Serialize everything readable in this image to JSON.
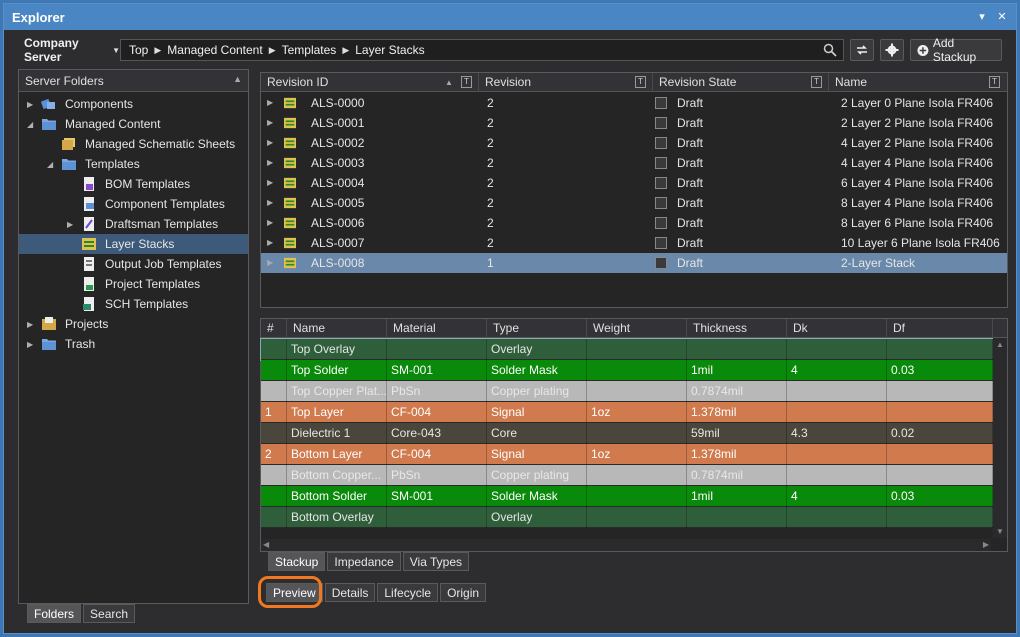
{
  "window": {
    "title": "Explorer"
  },
  "toolbar": {
    "server_label": "Company Server",
    "breadcrumb": [
      "Top",
      "Managed Content",
      "Templates",
      "Layer Stacks"
    ],
    "add_label": "Add Stackup"
  },
  "folders": {
    "header": "Server Folders",
    "items": [
      {
        "label": "Components",
        "level": 0,
        "expand": "collapsed",
        "icon": "components-icon"
      },
      {
        "label": "Managed Content",
        "level": 0,
        "expand": "expanded",
        "icon": "folder-icon"
      },
      {
        "label": "Managed Schematic Sheets",
        "level": 1,
        "expand": "none",
        "icon": "schematic-sheets-icon"
      },
      {
        "label": "Templates",
        "level": 1,
        "expand": "expanded",
        "icon": "folder-icon"
      },
      {
        "label": "BOM Templates",
        "level": 2,
        "expand": "none",
        "icon": "bom-template-icon"
      },
      {
        "label": "Component Templates",
        "level": 2,
        "expand": "none",
        "icon": "component-template-icon"
      },
      {
        "label": "Draftsman Templates",
        "level": 2,
        "expand": "collapsed",
        "icon": "draftsman-template-icon"
      },
      {
        "label": "Layer Stacks",
        "level": 2,
        "expand": "none",
        "icon": "layer-stack-icon",
        "selected": true
      },
      {
        "label": "Output Job Templates",
        "level": 2,
        "expand": "none",
        "icon": "output-job-icon"
      },
      {
        "label": "Project Templates",
        "level": 2,
        "expand": "none",
        "icon": "project-template-icon"
      },
      {
        "label": "SCH Templates",
        "level": 2,
        "expand": "none",
        "icon": "sch-template-icon"
      },
      {
        "label": "Projects",
        "level": 0,
        "expand": "collapsed",
        "icon": "projects-icon"
      },
      {
        "label": "Trash",
        "level": 0,
        "expand": "collapsed",
        "icon": "folder-icon"
      }
    ],
    "tabs": [
      "Folders",
      "Search"
    ]
  },
  "revisions": {
    "columns": [
      "Revision ID",
      "Revision",
      "Revision State",
      "Name"
    ],
    "rows": [
      {
        "id": "ALS-0000",
        "rev": "2",
        "state": "Draft",
        "name": "2 Layer 0 Plane Isola FR406"
      },
      {
        "id": "ALS-0001",
        "rev": "2",
        "state": "Draft",
        "name": "2 Layer 2 Plane Isola FR406"
      },
      {
        "id": "ALS-0002",
        "rev": "2",
        "state": "Draft",
        "name": "4 Layer 2 Plane Isola FR406"
      },
      {
        "id": "ALS-0003",
        "rev": "2",
        "state": "Draft",
        "name": "4 Layer 4 Plane Isola FR406"
      },
      {
        "id": "ALS-0004",
        "rev": "2",
        "state": "Draft",
        "name": "6 Layer 4 Plane Isola FR406"
      },
      {
        "id": "ALS-0005",
        "rev": "2",
        "state": "Draft",
        "name": "8 Layer 4 Plane Isola FR406"
      },
      {
        "id": "ALS-0006",
        "rev": "2",
        "state": "Draft",
        "name": "8 Layer 6 Plane Isola FR406"
      },
      {
        "id": "ALS-0007",
        "rev": "2",
        "state": "Draft",
        "name": "10 Layer 6 Plane Isola FR406"
      },
      {
        "id": "ALS-0008",
        "rev": "1",
        "state": "Draft",
        "name": "2-Layer Stack",
        "selected": true
      }
    ]
  },
  "stackup": {
    "columns": [
      "#",
      "Name",
      "Material",
      "Type",
      "Weight",
      "Thickness",
      "Dk",
      "Df"
    ],
    "rows": [
      {
        "num": "",
        "name": "Top Overlay",
        "material": "",
        "type": "Overlay",
        "weight": "",
        "thickness": "",
        "dk": "",
        "df": "",
        "color": "#2f5f3a",
        "text": "#e6e6e6"
      },
      {
        "num": "",
        "name": "Top Solder",
        "material": "SM-001",
        "type": "Solder Mask",
        "weight": "",
        "thickness": "1mil",
        "dk": "4",
        "df": "0.03",
        "color": "#0a8a0a",
        "text": "#ffffff"
      },
      {
        "num": "",
        "name": "Top Copper Plat...",
        "material": "PbSn",
        "type": "Copper plating",
        "weight": "",
        "thickness": "0.7874mil",
        "dk": "",
        "df": "",
        "color": "#b8b8b8",
        "text": "#e8e8e8"
      },
      {
        "num": "1",
        "name": "Top Layer",
        "material": "CF-004",
        "type": "Signal",
        "weight": "1oz",
        "thickness": "1.378mil",
        "dk": "",
        "df": "",
        "color": "#d07a4e",
        "text": "#ffffff"
      },
      {
        "num": "",
        "name": "Dielectric 1",
        "material": "Core-043",
        "type": "Core",
        "weight": "",
        "thickness": "59mil",
        "dk": "4.3",
        "df": "0.02",
        "color": "#4a463c",
        "text": "#e6e6e6"
      },
      {
        "num": "2",
        "name": "Bottom Layer",
        "material": "CF-004",
        "type": "Signal",
        "weight": "1oz",
        "thickness": "1.378mil",
        "dk": "",
        "df": "",
        "color": "#d07a4e",
        "text": "#ffffff"
      },
      {
        "num": "",
        "name": "Bottom Copper...",
        "material": "PbSn",
        "type": "Copper plating",
        "weight": "",
        "thickness": "0.7874mil",
        "dk": "",
        "df": "",
        "color": "#b8b8b8",
        "text": "#e8e8e8"
      },
      {
        "num": "",
        "name": "Bottom Solder",
        "material": "SM-001",
        "type": "Solder Mask",
        "weight": "",
        "thickness": "1mil",
        "dk": "4",
        "df": "0.03",
        "color": "#0a8a0a",
        "text": "#ffffff"
      },
      {
        "num": "",
        "name": "Bottom Overlay",
        "material": "",
        "type": "Overlay",
        "weight": "",
        "thickness": "",
        "dk": "",
        "df": "",
        "color": "#2f5f3a",
        "text": "#e6e6e6"
      }
    ],
    "tabs": [
      "Stackup",
      "Impedance",
      "Via Types"
    ]
  },
  "detail_tabs": [
    "Preview",
    "Details",
    "Lifecycle",
    "Origin"
  ]
}
